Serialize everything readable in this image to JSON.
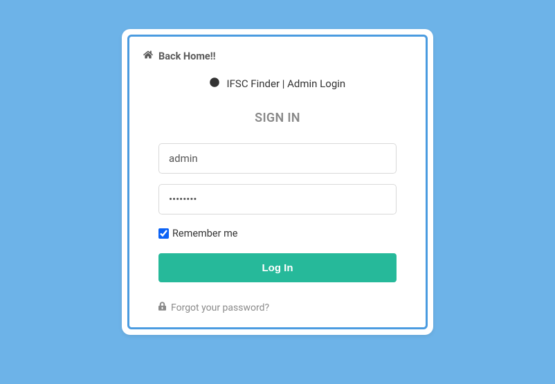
{
  "header": {
    "back_home_label": "Back Home!!",
    "brand_text": "IFSC Finder | Admin Login"
  },
  "form": {
    "title": "SIGN IN",
    "username_value": "admin",
    "username_placeholder": "",
    "password_value": "••••••••",
    "password_placeholder": "",
    "remember_label": "Remember me",
    "remember_checked": true,
    "login_button_label": "Log In",
    "forgot_label": "Forgot your password?"
  }
}
